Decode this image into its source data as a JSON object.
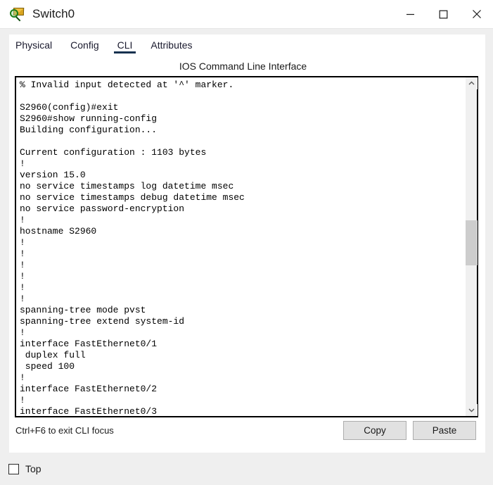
{
  "window": {
    "title": "Switch0",
    "icon": "switch-magnifier-icon",
    "controls": {
      "minimize": "minimize-icon",
      "maximize": "maximize-icon",
      "close": "close-icon"
    }
  },
  "tabs": [
    {
      "label": "Physical",
      "active": false
    },
    {
      "label": "Config",
      "active": false
    },
    {
      "label": "CLI",
      "active": true
    },
    {
      "label": "Attributes",
      "active": false
    }
  ],
  "cli": {
    "header": "IOS Command Line Interface",
    "lines": [
      "% Invalid input detected at '^' marker.",
      "",
      "S2960(config)#exit",
      "S2960#show running-config",
      "Building configuration...",
      "",
      "Current configuration : 1103 bytes",
      "!",
      "version 15.0",
      "no service timestamps log datetime msec",
      "no service timestamps debug datetime msec",
      "no service password-encryption",
      "!",
      "hostname S2960",
      "!",
      "!",
      "!",
      "!",
      "!",
      "!",
      "spanning-tree mode pvst",
      "spanning-tree extend system-id",
      "!",
      "interface FastEthernet0/1",
      " duplex full",
      " speed 100",
      "!",
      "interface FastEthernet0/2",
      "!",
      "interface FastEthernet0/3"
    ],
    "scrollbar": {
      "up_arrow": "chevron-up-icon",
      "down_arrow": "chevron-down-icon"
    }
  },
  "footer": {
    "hint": "Ctrl+F6 to exit CLI focus",
    "copy_label": "Copy",
    "paste_label": "Paste"
  },
  "bottom": {
    "top_checkbox_label": "Top",
    "top_checked": false
  },
  "colors": {
    "accent": "#16314f",
    "window_bg": "#efefef",
    "panel_bg": "#ffffff",
    "terminal_border": "#000000",
    "button_face": "#e1e1e1",
    "scroll_thumb": "#cdcdcd"
  }
}
